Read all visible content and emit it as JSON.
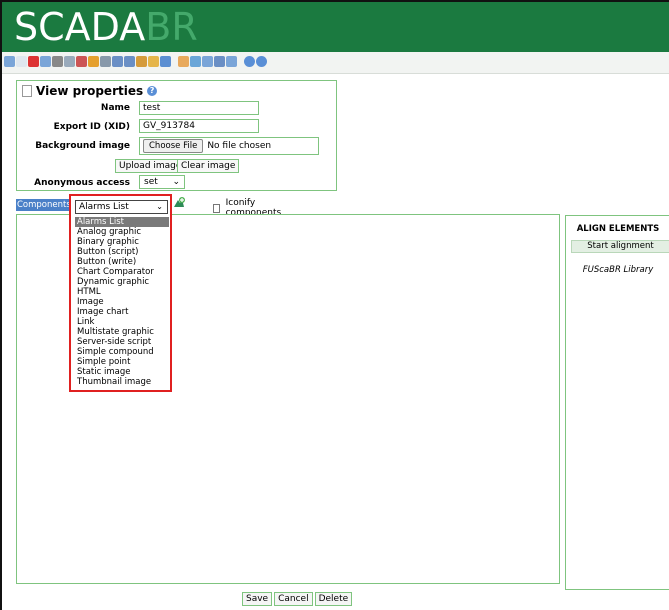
{
  "brand": {
    "part1": "SCADA",
    "part2": "BR"
  },
  "toolbar": {
    "icons": [
      "eye-icon",
      "new-icon",
      "edit-icon",
      "list-icon",
      "gear-icon",
      "cylinder-icon",
      "clock-icon",
      "pencil-icon",
      "link-icon",
      "book-icon",
      "users-icon",
      "user-icon",
      "folder-icon",
      "grid-icon",
      "paint-icon",
      "tools-icon",
      "sql-icon",
      "refresh-icon",
      "doc-icon",
      "target-icon",
      "help-icon"
    ],
    "colors": [
      "#7aa5d8",
      "#dfe7ef",
      "#d33",
      "#7aa5d8",
      "#888",
      "#9ab",
      "#c55",
      "#e5a02e",
      "#8899aa",
      "#6a8fc5",
      "#6a8fc5",
      "#d59b3b",
      "#e5b54a",
      "#5c8fd2",
      "#e8a95c",
      "#6aa6d8",
      "#7aa5d8",
      "#6a8fc5",
      "#7aa5d8",
      "#5a8fd6",
      "#5a8fd6"
    ]
  },
  "view_properties": {
    "title": "View properties",
    "name_label": "Name",
    "name_value": "test",
    "xid_label": "Export ID (XID)",
    "xid_value": "GV_913784",
    "bg_label": "Background image",
    "choose_file": "Choose File",
    "no_file": "No file chosen",
    "upload_btn": "Upload image",
    "clear_btn": "Clear image",
    "anon_label": "Anonymous access",
    "anon_value": "set"
  },
  "components": {
    "label": "Components:",
    "selected": "Alarms List",
    "iconify": "Iconify components",
    "options": [
      "Alarms List",
      "Analog graphic",
      "Binary graphic",
      "Button (script)",
      "Button (write)",
      "Chart Comparator",
      "Dynamic graphic",
      "HTML",
      "Image",
      "Image chart",
      "Link",
      "Multistate graphic",
      "Server-side script",
      "Simple compound",
      "Simple point",
      "Static image",
      "Thumbnail image"
    ]
  },
  "align": {
    "title": "ALIGN ELEMENTS",
    "start": "Start alignment",
    "library": "FUScaBR Library"
  },
  "actions": {
    "save": "Save",
    "cancel": "Cancel",
    "delete": "Delete"
  }
}
